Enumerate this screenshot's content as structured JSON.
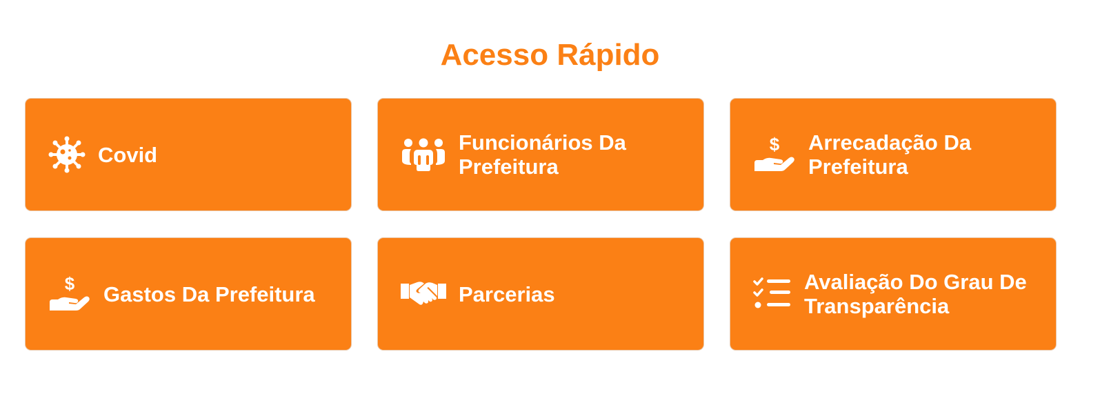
{
  "section": {
    "title": "Acesso Rápido"
  },
  "colors": {
    "accent": "#fb8015",
    "text_on_accent": "#ffffff",
    "card_border": "#e9c7a9"
  },
  "cards": [
    {
      "label": "Covid",
      "icon": "virus-icon"
    },
    {
      "label": "Funcionários Da Prefeitura",
      "icon": "people-group-icon"
    },
    {
      "label": "Arrecadação Da Prefeitura",
      "icon": "hand-holding-dollar-icon"
    },
    {
      "label": "Gastos Da Prefeitura",
      "icon": "hand-holding-dollar-icon"
    },
    {
      "label": "Parcerias",
      "icon": "handshake-icon"
    },
    {
      "label": "Avaliação Do Grau De Transparência",
      "icon": "checklist-icon"
    }
  ]
}
